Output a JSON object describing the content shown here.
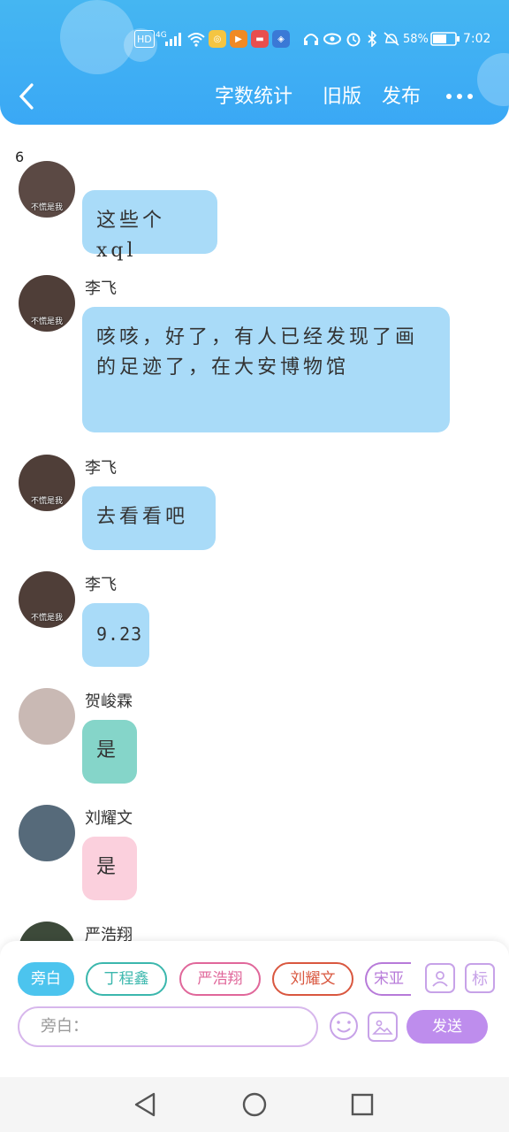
{
  "statusbar": {
    "hd": "HD",
    "net": "4G",
    "battery_pct": "58%",
    "time": "7:02"
  },
  "header": {
    "back_icon": "‹",
    "word_count": "字数统计",
    "old_version": "旧版",
    "publish": "发布"
  },
  "word_count_value": "6",
  "messages": [
    {
      "sender": "",
      "text": "这些个xql",
      "color": "#a9dbf8",
      "avatar_caption": "不慌是我"
    },
    {
      "sender": "李飞",
      "text": "咳咳，好了，有人已经发现了画的足迹了，在大安博物馆",
      "color": "#a9dbf8",
      "avatar_caption": "不慌是我"
    },
    {
      "sender": "李飞",
      "text": "去看看吧",
      "color": "#a9dbf8",
      "avatar_caption": "不慌是我"
    },
    {
      "sender": "李飞",
      "text": "9.23",
      "color": "#a9dbf8",
      "avatar_caption": "不慌是我"
    },
    {
      "sender": "贺峻霖",
      "text": "是",
      "color": "#85d5c9",
      "avatar_caption": ""
    },
    {
      "sender": "刘耀文",
      "text": "是",
      "color": "#fbd0dd",
      "avatar_caption": ""
    },
    {
      "sender": "严浩翔",
      "text": "",
      "color": "#a9dbf8",
      "avatar_caption": ""
    }
  ],
  "chips": [
    {
      "label": "旁白",
      "color": "#4cc4ee",
      "active": true
    },
    {
      "label": "丁程鑫",
      "color": "#3bb7ad"
    },
    {
      "label": "严浩翔",
      "color": "#e0679a"
    },
    {
      "label": "刘耀文",
      "color": "#d9573f"
    },
    {
      "label": "宋亚",
      "color": "#b77ad9"
    }
  ],
  "tools": {
    "person_icon": "person-card-icon",
    "tag_label": "标",
    "emoji_icon": "smile-icon",
    "image_icon": "image-icon"
  },
  "input": {
    "placeholder": "旁白："
  },
  "send_label": "发送"
}
